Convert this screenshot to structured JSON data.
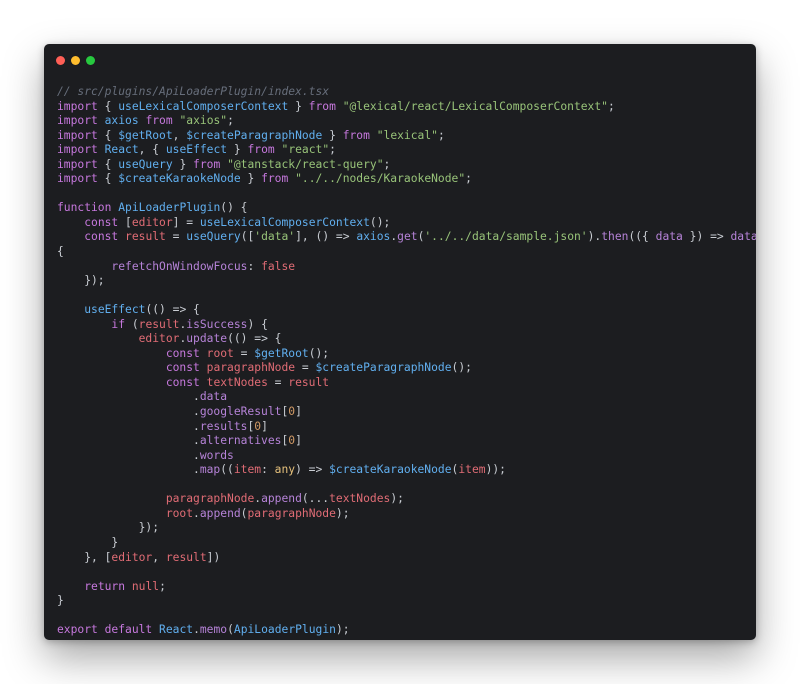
{
  "window": {
    "controls": {
      "close_color": "#ff5f56",
      "minimize_color": "#ffbd2e",
      "maximize_color": "#27c93f"
    }
  },
  "code": {
    "language": "tsx",
    "lines": [
      [
        {
          "t": "// src/plugins/ApiLoaderPlugin/index.tsx",
          "c": "comment"
        }
      ],
      [
        {
          "t": "import",
          "c": "keyword"
        },
        {
          "t": " { ",
          "c": "punct"
        },
        {
          "t": "useLexicalComposerContext",
          "c": "func"
        },
        {
          "t": " } ",
          "c": "punct"
        },
        {
          "t": "from",
          "c": "keyword"
        },
        {
          "t": " ",
          "c": "plain"
        },
        {
          "t": "\"@lexical/react/LexicalComposerContext\"",
          "c": "string"
        },
        {
          "t": ";",
          "c": "punct"
        }
      ],
      [
        {
          "t": "import",
          "c": "keyword"
        },
        {
          "t": " ",
          "c": "plain"
        },
        {
          "t": "axios",
          "c": "func"
        },
        {
          "t": " ",
          "c": "plain"
        },
        {
          "t": "from",
          "c": "keyword"
        },
        {
          "t": " ",
          "c": "plain"
        },
        {
          "t": "\"axios\"",
          "c": "string"
        },
        {
          "t": ";",
          "c": "punct"
        }
      ],
      [
        {
          "t": "import",
          "c": "keyword"
        },
        {
          "t": " { ",
          "c": "punct"
        },
        {
          "t": "$getRoot",
          "c": "func"
        },
        {
          "t": ", ",
          "c": "punct"
        },
        {
          "t": "$createParagraphNode",
          "c": "func"
        },
        {
          "t": " } ",
          "c": "punct"
        },
        {
          "t": "from",
          "c": "keyword"
        },
        {
          "t": " ",
          "c": "plain"
        },
        {
          "t": "\"lexical\"",
          "c": "string"
        },
        {
          "t": ";",
          "c": "punct"
        }
      ],
      [
        {
          "t": "import",
          "c": "keyword"
        },
        {
          "t": " ",
          "c": "plain"
        },
        {
          "t": "React",
          "c": "func"
        },
        {
          "t": ", { ",
          "c": "punct"
        },
        {
          "t": "useEffect",
          "c": "func"
        },
        {
          "t": " } ",
          "c": "punct"
        },
        {
          "t": "from",
          "c": "keyword"
        },
        {
          "t": " ",
          "c": "plain"
        },
        {
          "t": "\"react\"",
          "c": "string"
        },
        {
          "t": ";",
          "c": "punct"
        }
      ],
      [
        {
          "t": "import",
          "c": "keyword"
        },
        {
          "t": " { ",
          "c": "punct"
        },
        {
          "t": "useQuery",
          "c": "func"
        },
        {
          "t": " } ",
          "c": "punct"
        },
        {
          "t": "from",
          "c": "keyword"
        },
        {
          "t": " ",
          "c": "plain"
        },
        {
          "t": "\"@tanstack/react-query\"",
          "c": "string"
        },
        {
          "t": ";",
          "c": "punct"
        }
      ],
      [
        {
          "t": "import",
          "c": "keyword"
        },
        {
          "t": " { ",
          "c": "punct"
        },
        {
          "t": "$createKaraokeNode",
          "c": "func"
        },
        {
          "t": " } ",
          "c": "punct"
        },
        {
          "t": "from",
          "c": "keyword"
        },
        {
          "t": " ",
          "c": "plain"
        },
        {
          "t": "\"../../nodes/KaraokeNode\"",
          "c": "string"
        },
        {
          "t": ";",
          "c": "punct"
        }
      ],
      [],
      [
        {
          "t": "function",
          "c": "keyword"
        },
        {
          "t": " ",
          "c": "plain"
        },
        {
          "t": "ApiLoaderPlugin",
          "c": "func"
        },
        {
          "t": "() {",
          "c": "punct"
        }
      ],
      [
        {
          "t": "    ",
          "c": "plain"
        },
        {
          "t": "const",
          "c": "keyword"
        },
        {
          "t": " [",
          "c": "punct"
        },
        {
          "t": "editor",
          "c": "ident"
        },
        {
          "t": "] = ",
          "c": "punct"
        },
        {
          "t": "useLexicalComposerContext",
          "c": "func"
        },
        {
          "t": "();",
          "c": "punct"
        }
      ],
      [
        {
          "t": "    ",
          "c": "plain"
        },
        {
          "t": "const",
          "c": "keyword"
        },
        {
          "t": " ",
          "c": "plain"
        },
        {
          "t": "result",
          "c": "ident"
        },
        {
          "t": " = ",
          "c": "punct"
        },
        {
          "t": "useQuery",
          "c": "func"
        },
        {
          "t": "([",
          "c": "punct"
        },
        {
          "t": "'data'",
          "c": "string"
        },
        {
          "t": "], () => ",
          "c": "punct"
        },
        {
          "t": "axios",
          "c": "func"
        },
        {
          "t": ".",
          "c": "punct"
        },
        {
          "t": "get",
          "c": "member"
        },
        {
          "t": "(",
          "c": "punct"
        },
        {
          "t": "'../../data/sample.json'",
          "c": "string"
        },
        {
          "t": ").",
          "c": "punct"
        },
        {
          "t": "then",
          "c": "member"
        },
        {
          "t": "(({ ",
          "c": "punct"
        },
        {
          "t": "data",
          "c": "member"
        },
        {
          "t": " }) => ",
          "c": "punct"
        },
        {
          "t": "data",
          "c": "member"
        },
        {
          "t": "),",
          "c": "punct"
        }
      ],
      [
        {
          "t": "{",
          "c": "punct"
        }
      ],
      [
        {
          "t": "        ",
          "c": "plain"
        },
        {
          "t": "refetchOnWindowFocus",
          "c": "member"
        },
        {
          "t": ": ",
          "c": "punct"
        },
        {
          "t": "false",
          "c": "bool"
        }
      ],
      [
        {
          "t": "    });",
          "c": "punct"
        }
      ],
      [],
      [
        {
          "t": "    ",
          "c": "plain"
        },
        {
          "t": "useEffect",
          "c": "func"
        },
        {
          "t": "(() => {",
          "c": "punct"
        }
      ],
      [
        {
          "t": "        ",
          "c": "plain"
        },
        {
          "t": "if",
          "c": "keyword"
        },
        {
          "t": " (",
          "c": "punct"
        },
        {
          "t": "result",
          "c": "ident"
        },
        {
          "t": ".",
          "c": "punct"
        },
        {
          "t": "isSuccess",
          "c": "member"
        },
        {
          "t": ") {",
          "c": "punct"
        }
      ],
      [
        {
          "t": "            ",
          "c": "plain"
        },
        {
          "t": "editor",
          "c": "ident"
        },
        {
          "t": ".",
          "c": "punct"
        },
        {
          "t": "update",
          "c": "member"
        },
        {
          "t": "(() => {",
          "c": "punct"
        }
      ],
      [
        {
          "t": "                ",
          "c": "plain"
        },
        {
          "t": "const",
          "c": "keyword"
        },
        {
          "t": " ",
          "c": "plain"
        },
        {
          "t": "root",
          "c": "ident"
        },
        {
          "t": " = ",
          "c": "punct"
        },
        {
          "t": "$getRoot",
          "c": "func"
        },
        {
          "t": "();",
          "c": "punct"
        }
      ],
      [
        {
          "t": "                ",
          "c": "plain"
        },
        {
          "t": "const",
          "c": "keyword"
        },
        {
          "t": " ",
          "c": "plain"
        },
        {
          "t": "paragraphNode",
          "c": "ident"
        },
        {
          "t": " = ",
          "c": "punct"
        },
        {
          "t": "$createParagraphNode",
          "c": "func"
        },
        {
          "t": "();",
          "c": "punct"
        }
      ],
      [
        {
          "t": "                ",
          "c": "plain"
        },
        {
          "t": "const",
          "c": "keyword"
        },
        {
          "t": " ",
          "c": "plain"
        },
        {
          "t": "textNodes",
          "c": "ident"
        },
        {
          "t": " = ",
          "c": "punct"
        },
        {
          "t": "result",
          "c": "ident"
        }
      ],
      [
        {
          "t": "                    .",
          "c": "punct"
        },
        {
          "t": "data",
          "c": "member"
        }
      ],
      [
        {
          "t": "                    .",
          "c": "punct"
        },
        {
          "t": "googleResult",
          "c": "member"
        },
        {
          "t": "[",
          "c": "punct"
        },
        {
          "t": "0",
          "c": "number"
        },
        {
          "t": "]",
          "c": "punct"
        }
      ],
      [
        {
          "t": "                    .",
          "c": "punct"
        },
        {
          "t": "results",
          "c": "member"
        },
        {
          "t": "[",
          "c": "punct"
        },
        {
          "t": "0",
          "c": "number"
        },
        {
          "t": "]",
          "c": "punct"
        }
      ],
      [
        {
          "t": "                    .",
          "c": "punct"
        },
        {
          "t": "alternatives",
          "c": "member"
        },
        {
          "t": "[",
          "c": "punct"
        },
        {
          "t": "0",
          "c": "number"
        },
        {
          "t": "]",
          "c": "punct"
        }
      ],
      [
        {
          "t": "                    .",
          "c": "punct"
        },
        {
          "t": "words",
          "c": "member"
        }
      ],
      [
        {
          "t": "                    .",
          "c": "punct"
        },
        {
          "t": "map",
          "c": "member"
        },
        {
          "t": "((",
          "c": "punct"
        },
        {
          "t": "item",
          "c": "ident"
        },
        {
          "t": ": ",
          "c": "punct"
        },
        {
          "t": "any",
          "c": "type"
        },
        {
          "t": ") => ",
          "c": "punct"
        },
        {
          "t": "$createKaraokeNode",
          "c": "func"
        },
        {
          "t": "(",
          "c": "punct"
        },
        {
          "t": "item",
          "c": "ident"
        },
        {
          "t": "));",
          "c": "punct"
        }
      ],
      [],
      [
        {
          "t": "                ",
          "c": "plain"
        },
        {
          "t": "paragraphNode",
          "c": "ident"
        },
        {
          "t": ".",
          "c": "punct"
        },
        {
          "t": "append",
          "c": "member"
        },
        {
          "t": "(...",
          "c": "punct"
        },
        {
          "t": "textNodes",
          "c": "ident"
        },
        {
          "t": ");",
          "c": "punct"
        }
      ],
      [
        {
          "t": "                ",
          "c": "plain"
        },
        {
          "t": "root",
          "c": "ident"
        },
        {
          "t": ".",
          "c": "punct"
        },
        {
          "t": "append",
          "c": "member"
        },
        {
          "t": "(",
          "c": "punct"
        },
        {
          "t": "paragraphNode",
          "c": "ident"
        },
        {
          "t": ");",
          "c": "punct"
        }
      ],
      [
        {
          "t": "            });",
          "c": "punct"
        }
      ],
      [
        {
          "t": "        }",
          "c": "punct"
        }
      ],
      [
        {
          "t": "    }, [",
          "c": "punct"
        },
        {
          "t": "editor",
          "c": "ident"
        },
        {
          "t": ", ",
          "c": "punct"
        },
        {
          "t": "result",
          "c": "ident"
        },
        {
          "t": "])",
          "c": "punct"
        }
      ],
      [],
      [
        {
          "t": "    ",
          "c": "plain"
        },
        {
          "t": "return",
          "c": "keyword"
        },
        {
          "t": " ",
          "c": "plain"
        },
        {
          "t": "null",
          "c": "bool"
        },
        {
          "t": ";",
          "c": "punct"
        }
      ],
      [
        {
          "t": "}",
          "c": "punct"
        }
      ],
      [],
      [
        {
          "t": "export",
          "c": "keyword"
        },
        {
          "t": " ",
          "c": "plain"
        },
        {
          "t": "default",
          "c": "keyword"
        },
        {
          "t": " ",
          "c": "plain"
        },
        {
          "t": "React",
          "c": "func"
        },
        {
          "t": ".",
          "c": "punct"
        },
        {
          "t": "memo",
          "c": "member"
        },
        {
          "t": "(",
          "c": "punct"
        },
        {
          "t": "ApiLoaderPlugin",
          "c": "func"
        },
        {
          "t": ");",
          "c": "punct"
        }
      ]
    ]
  }
}
